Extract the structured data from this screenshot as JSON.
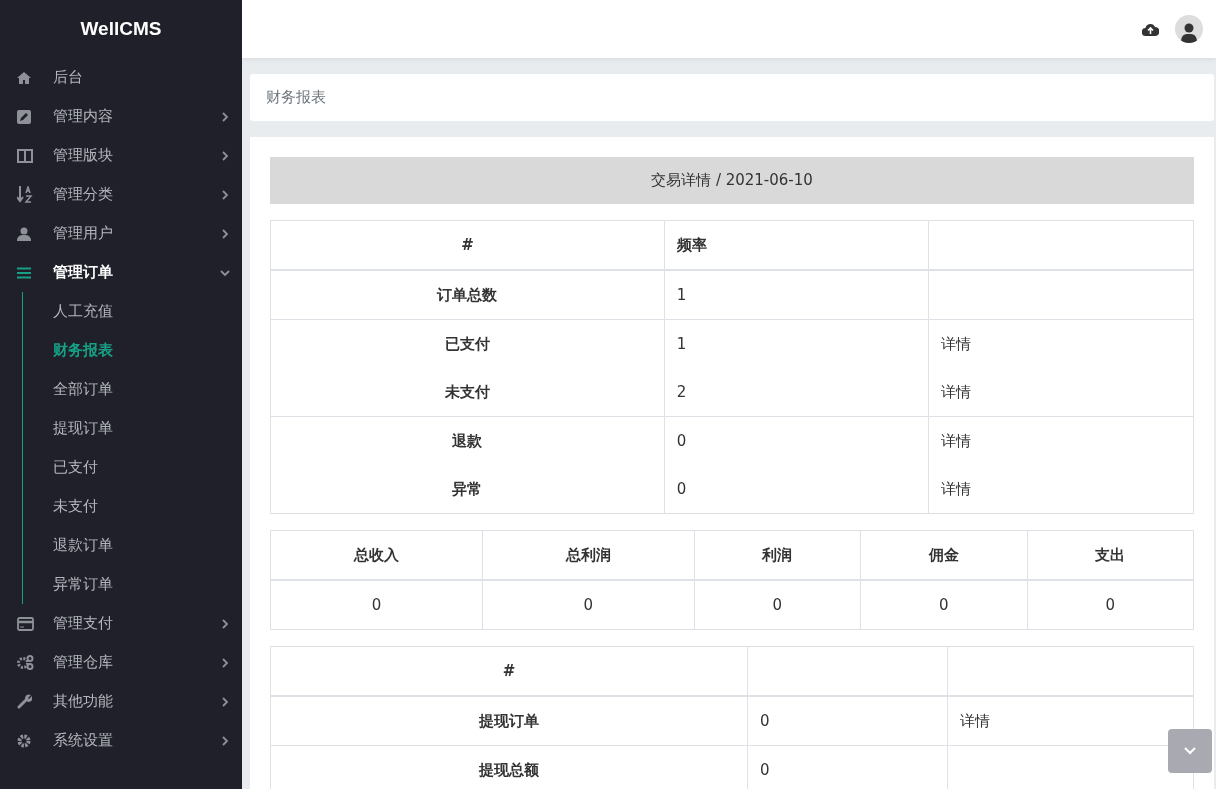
{
  "sidebar": {
    "brand": "WellCMS",
    "items": [
      {
        "label": "后台",
        "kind": "link"
      },
      {
        "label": "管理内容",
        "kind": "menu",
        "expanded": false
      },
      {
        "label": "管理版块",
        "kind": "menu",
        "expanded": false
      },
      {
        "label": "管理分类",
        "kind": "menu",
        "expanded": false
      },
      {
        "label": "管理用户",
        "kind": "menu",
        "expanded": false
      },
      {
        "label": "管理订单",
        "kind": "menu",
        "expanded": true,
        "children": [
          {
            "label": "人工充值",
            "selected": false
          },
          {
            "label": "财务报表",
            "selected": true
          },
          {
            "label": "全部订单",
            "selected": false
          },
          {
            "label": "提现订单",
            "selected": false
          },
          {
            "label": "已支付",
            "selected": false
          },
          {
            "label": "未支付",
            "selected": false
          },
          {
            "label": "退款订单",
            "selected": false
          },
          {
            "label": "异常订单",
            "selected": false
          }
        ]
      },
      {
        "label": "管理支付",
        "kind": "menu",
        "expanded": false
      },
      {
        "label": "管理仓库",
        "kind": "menu",
        "expanded": false
      },
      {
        "label": "其他功能",
        "kind": "menu",
        "expanded": false
      },
      {
        "label": "系统设置",
        "kind": "menu",
        "expanded": false
      }
    ]
  },
  "breadcrumb": "财务报表",
  "report": {
    "title": "交易详情 / 2021-06-10",
    "orders_table": {
      "columns": [
        "#",
        "频率",
        ""
      ],
      "groups": [
        [
          {
            "label": "订单总数",
            "count": "1"
          }
        ],
        [
          {
            "label": "已支付",
            "count": "1",
            "link": "详情"
          },
          {
            "label": "未支付",
            "count": "2",
            "link": "详情"
          }
        ],
        [
          {
            "label": "退款",
            "count": "0",
            "link": "详情"
          },
          {
            "label": "异常",
            "count": "0",
            "link": "详情"
          }
        ]
      ]
    },
    "totals_table": {
      "columns": [
        "总收入",
        "总利润",
        "利润",
        "佣金",
        "支出"
      ],
      "values": [
        "0",
        "0",
        "0",
        "0",
        "0"
      ]
    },
    "withdraw_table": {
      "columns": [
        "#",
        "",
        ""
      ],
      "rows": [
        {
          "label": "提现订单",
          "count": "0",
          "link": "详情"
        },
        {
          "label": "提现总额",
          "count": "0"
        }
      ]
    }
  }
}
